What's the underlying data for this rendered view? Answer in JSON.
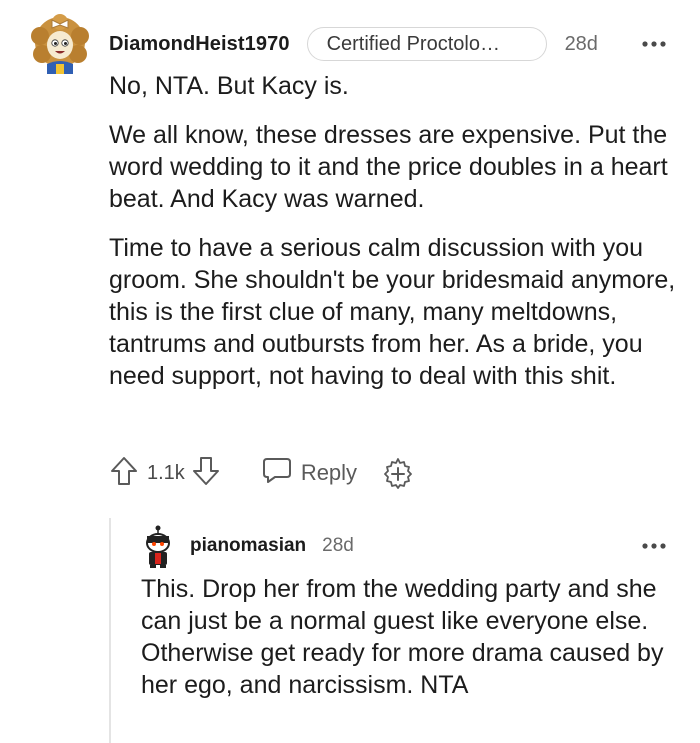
{
  "comment": {
    "username": "DiamondHeist1970",
    "flair": "Certified Proctolo…",
    "time": "28d",
    "paragraphs": [
      "No, NTA. But Kacy is.",
      "We all know, these dresses are expensive. Put the word wedding to it and the price doubles in a heart beat. And Kacy was warned.",
      "Time to have a serious calm discussion with you groom. She shouldn't be your bridesmaid anymore, this is the first clue of many, many meltdowns, tantrums and outbursts from her. As a bride, you need support, not having to deal with this shit."
    ],
    "votes": "1.1k",
    "reply_label": "Reply",
    "icons": [
      "avatar",
      "more-icon",
      "upvote-icon",
      "downvote-icon",
      "reply-icon",
      "award-icon"
    ]
  },
  "reply": {
    "username": "pianomasian",
    "time": "28d",
    "text": "This. Drop her from the wedding party and she can just be a normal guest like everyone else. Otherwise get ready for more drama caused by her ego, and narcissism. NTA",
    "icons": [
      "avatar",
      "more-icon"
    ]
  },
  "colors": {
    "text": "#1c1c1c",
    "meta": "#6a6a6a",
    "avatar_hair": "#c48a3a",
    "avatar_face": "#f5e6c8",
    "avatar_shirt": "#2f5fb3"
  }
}
